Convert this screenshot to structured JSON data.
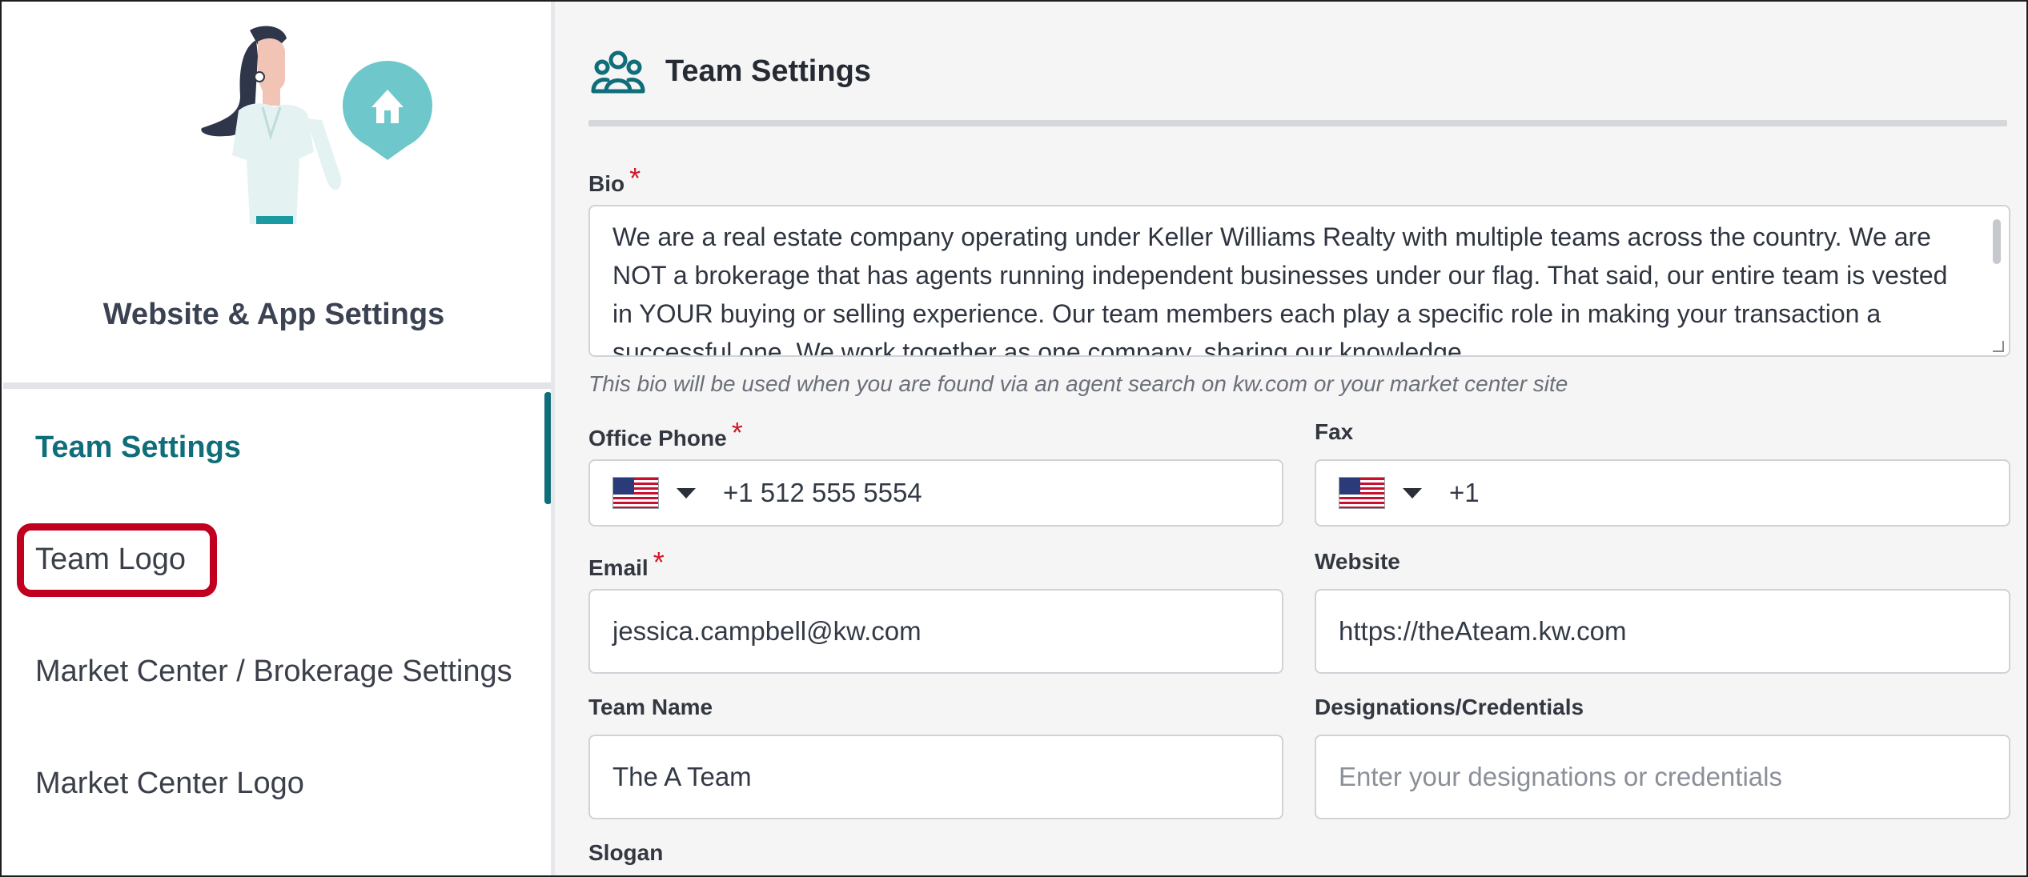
{
  "sidebar": {
    "title": "Website & App Settings",
    "items": [
      {
        "label": "Team Settings",
        "active": true
      },
      {
        "label": "Team Logo",
        "active": false
      },
      {
        "label": "Market Center / Brokerage Settings",
        "active": false
      },
      {
        "label": "Market Center Logo",
        "active": false
      }
    ]
  },
  "main": {
    "title": "Team Settings",
    "bio": {
      "label": "Bio",
      "required_mark": "*",
      "value": "We are a real estate company operating under Keller Williams Realty with multiple teams across the country. We are NOT a brokerage that has agents running independent businesses under our flag. That said, our entire team is vested in YOUR buying or selling experience. Our team members each play a specific role in making your transaction a successful one. We work together as one company, sharing our knowledge",
      "hint": "This bio will be used when you are found via an agent search on kw.com or your market center site"
    },
    "office_phone": {
      "label": "Office Phone",
      "required_mark": "*",
      "value": "+1 512 555 5554"
    },
    "fax": {
      "label": "Fax",
      "value": "+1"
    },
    "email": {
      "label": "Email",
      "required_mark": "*",
      "value": "jessica.campbell@kw.com"
    },
    "website": {
      "label": "Website",
      "value": "https://theAteam.kw.com"
    },
    "team_name": {
      "label": "Team Name",
      "value": "The A Team"
    },
    "designations": {
      "label": "Designations/Credentials",
      "placeholder": "Enter your designations or credentials"
    },
    "slogan": {
      "label": "Slogan"
    }
  },
  "colors": {
    "accent": "#0f6e7a",
    "required": "#d0182b",
    "highlight": "#c0001e"
  }
}
